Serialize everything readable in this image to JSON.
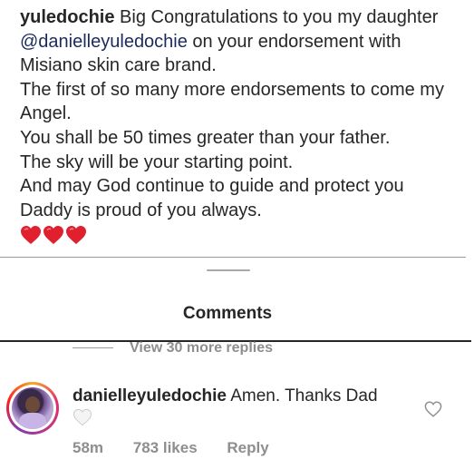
{
  "post_caption": {
    "username": "yuledochie",
    "line1_rest": " Big Congratulations to you my daughter",
    "mention": "@danielleyuledochie",
    "line2_rest": " on your endorsement with",
    "line3": "Misiano skin care brand.",
    "line4": "The first of so many more endorsements to come my",
    "line5": "Angel.",
    "line6": "You shall be 50 times greater than your father.",
    "line7": "The sky will be your starting point.",
    "line8": "And may God continue to guide and protect you",
    "line9": "Daddy is proud of you always.",
    "emoji": [
      "red-heart",
      "red-heart",
      "red-heart"
    ]
  },
  "comments_sheet": {
    "title": "Comments"
  },
  "replies": {
    "view_more_label": "View 30 more replies"
  },
  "comment": {
    "username": "danielleyuledochie",
    "text": " Amen. Thanks Dad",
    "emoji": "white-heart",
    "time": "58m",
    "likes": "783 likes",
    "reply_label": "Reply"
  },
  "colors": {
    "text": "#262626",
    "secondary_text": "#8e8e8e",
    "mention": "#1c2b5e",
    "heart_red": "#e0202e"
  }
}
